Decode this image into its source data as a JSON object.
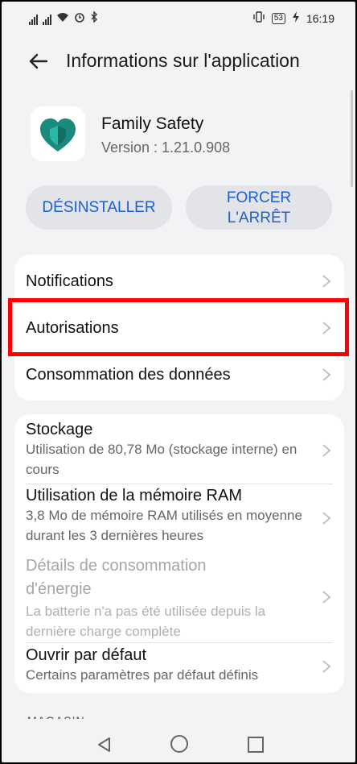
{
  "status_bar": {
    "time": "16:19",
    "battery": "53"
  },
  "header": {
    "title": "Informations sur l'application"
  },
  "app": {
    "name": "Family Safety",
    "version": "Version : 1.21.0.908"
  },
  "buttons": {
    "uninstall": "DÉSINSTALLER",
    "force_stop": "FORCER L'ARRÊT"
  },
  "card1": {
    "items": [
      {
        "label": "Notifications"
      },
      {
        "label": "Autorisations"
      },
      {
        "label": "Consommation des données"
      }
    ]
  },
  "card2": {
    "items": [
      {
        "label": "Stockage",
        "sub": "Utilisation de 80,78 Mo (stockage interne) en cours"
      },
      {
        "label": "Utilisation de la mémoire RAM",
        "sub": "3,8 Mo de mémoire RAM utilisés en moyenne durant les 3 dernières heures"
      },
      {
        "label": "Détails de consommation d'énergie",
        "sub": "La batterie n'a pas été utilisée depuis la dernière charge complète"
      },
      {
        "label": "Ouvrir par défaut",
        "sub": "Certains paramètres par défaut définis"
      }
    ]
  },
  "section": {
    "store": "MAGASIN"
  },
  "colors": {
    "accent": "#1e5fd0",
    "highlight": "#ff0000",
    "app_icon": "#1a8a7e"
  }
}
